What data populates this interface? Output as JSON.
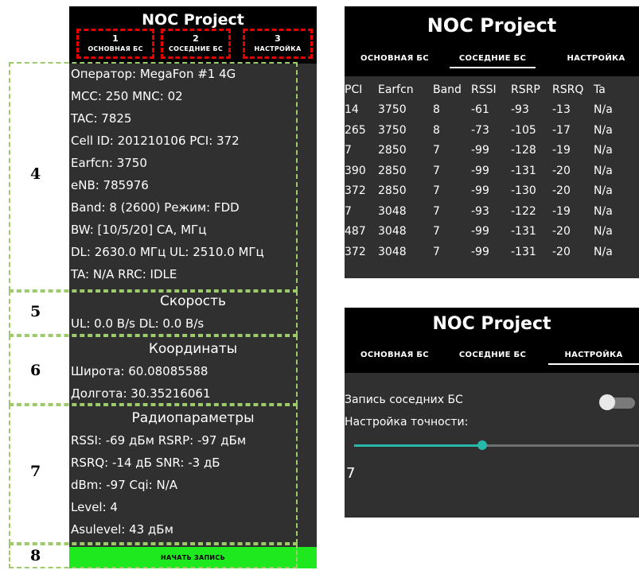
{
  "app_title": "NOC Project",
  "main_screen": {
    "tabs": [
      {
        "num": "1",
        "label": "ОСНОВНАЯ БС"
      },
      {
        "num": "2",
        "label": "СОСЕДНИЕ БС"
      },
      {
        "num": "3",
        "label": "НАСТРОЙКА"
      }
    ],
    "rows": [
      "Оператор: MegaFon #1 4G",
      "MCC: 250 MNC: 02",
      "TAC: 7825",
      "Cell ID: 201210106 PCI: 372",
      "Earfcn: 3750",
      "eNB: 785976",
      "Band: 8 (2600) Режим: FDD",
      "BW: [10/5/20] CA, МГц",
      "DL: 2630.0 МГц UL: 2510.0 МГц",
      "TA: N/A RRC: IDLE"
    ],
    "speed": {
      "title": "Скорость",
      "value": "UL: 0.0 B/s DL: 0.0 B/s"
    },
    "coords": {
      "title": "Координаты",
      "lat": "Широта: 60.08085588",
      "lon": "Долгота: 30.35216061"
    },
    "radio": {
      "title": "Радиопараметры",
      "rows": [
        "RSSI: -69 дБм RSRP: -97 дБм",
        "RSRQ: -14 дБ SNR: -3 дБ",
        "dBm: -97 Cqi: N/A",
        "Level: 4",
        "Asulevel: 43 дБм"
      ]
    },
    "record_button": "НАЧАТЬ ЗАПИСЬ"
  },
  "annotations": [
    "4",
    "5",
    "6",
    "7",
    "8"
  ],
  "neighbors_screen": {
    "tabs": [
      "ОСНОВНАЯ БС",
      "СОСЕДНИЕ БС",
      "НАСТРОЙКА"
    ],
    "active_tab": 1,
    "columns": [
      "PCI",
      "Earfcn",
      "Band",
      "RSSI",
      "RSRP",
      "RSRQ",
      "Ta"
    ],
    "rows": [
      [
        "14",
        "3750",
        "8",
        "-61",
        "-93",
        "-13",
        "N/a"
      ],
      [
        "265",
        "3750",
        "8",
        "-73",
        "-105",
        "-17",
        "N/a"
      ],
      [
        "7",
        "2850",
        "7",
        "-99",
        "-128",
        "-19",
        "N/a"
      ],
      [
        "390",
        "2850",
        "7",
        "-99",
        "-131",
        "-20",
        "N/a"
      ],
      [
        "372",
        "2850",
        "7",
        "-99",
        "-130",
        "-20",
        "N/a"
      ],
      [
        "7",
        "3048",
        "7",
        "-93",
        "-122",
        "-19",
        "N/a"
      ],
      [
        "487",
        "3048",
        "7",
        "-99",
        "-131",
        "-20",
        "N/a"
      ],
      [
        "372",
        "3048",
        "7",
        "-99",
        "-131",
        "-20",
        "N/a"
      ]
    ]
  },
  "settings_screen": {
    "tabs": [
      "ОСНОВНАЯ БС",
      "СОСЕДНИЕ БС",
      "НАСТРОЙКА"
    ],
    "active_tab": 2,
    "record_neighbors_label": "Запись соседних БС",
    "record_neighbors_on": false,
    "accuracy_label": "Настройка точности:",
    "accuracy_level": 0.45,
    "accuracy_value": "7"
  },
  "colors": {
    "screen_bg": "#303030",
    "titlebar_bg": "#000000",
    "record_button": "#1ee81e",
    "tab_highlight": "#e60000",
    "annotation": "#9dcb6b",
    "slider_accent": "#26b8a8"
  }
}
